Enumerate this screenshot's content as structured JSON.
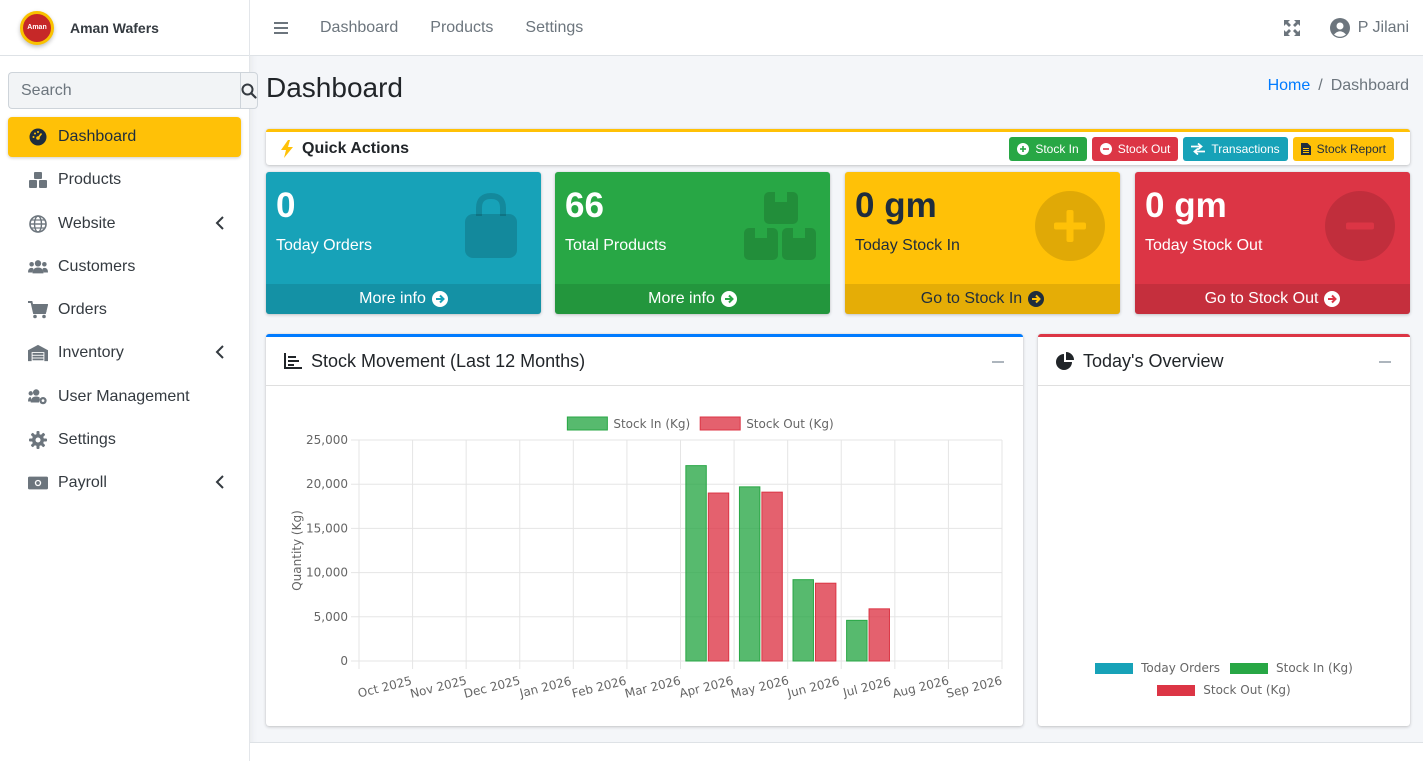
{
  "brand": {
    "logo_text": "Aman",
    "name": "Aman Wafers"
  },
  "search": {
    "placeholder": "Search"
  },
  "sidebar": {
    "items": [
      {
        "label": "Dashboard",
        "icon": "tachometer-icon",
        "active": true
      },
      {
        "label": "Products",
        "icon": "boxes-icon"
      },
      {
        "label": "Website",
        "icon": "globe-icon",
        "submenu": true
      },
      {
        "label": "Customers",
        "icon": "users-icon"
      },
      {
        "label": "Orders",
        "icon": "cart-icon"
      },
      {
        "label": "Inventory",
        "icon": "warehouse-icon",
        "submenu": true
      },
      {
        "label": "User Management",
        "icon": "users-cog-icon"
      },
      {
        "label": "Settings",
        "icon": "gear-icon"
      },
      {
        "label": "Payroll",
        "icon": "money-icon",
        "submenu": true
      }
    ]
  },
  "topnav": {
    "links": [
      "Dashboard",
      "Products",
      "Settings"
    ],
    "user_name": "P Jilani"
  },
  "header": {
    "title": "Dashboard",
    "breadcrumb_home": "Home",
    "breadcrumb_sep": "/",
    "breadcrumb_current": "Dashboard"
  },
  "quick_actions": {
    "title": "Quick Actions",
    "buttons": [
      "Stock In",
      "Stock Out",
      "Transactions",
      "Stock Report"
    ]
  },
  "boxes": [
    {
      "value": "0",
      "label": "Today Orders",
      "footer": "More info",
      "icon": "shopping-bag-icon"
    },
    {
      "value": "66",
      "label": "Total Products",
      "footer": "More info",
      "icon": "boxes-icon"
    },
    {
      "value": "0 gm",
      "label": "Today Stock In",
      "footer": "Go to Stock In",
      "icon": "plus-circle-icon"
    },
    {
      "value": "0 gm",
      "label": "Today Stock Out",
      "footer": "Go to Stock Out",
      "icon": "minus-circle-icon"
    }
  ],
  "colors": {
    "info": "#17a2b8",
    "success": "#28a745",
    "warning": "#ffc107",
    "danger": "#dc3545",
    "primary": "#007bff"
  },
  "stock_card": {
    "title": "Stock Movement (Last 12 Months)"
  },
  "overview_card": {
    "title": "Today's Overview",
    "legend": [
      "Today Orders",
      "Stock In (Kg)",
      "Stock Out (Kg)"
    ]
  },
  "chart_data": {
    "type": "bar",
    "categories": [
      "Oct 2025",
      "Nov 2025",
      "Dec 2025",
      "Jan 2026",
      "Feb 2026",
      "Mar 2026",
      "Apr 2026",
      "May 2026",
      "Jun 2026",
      "Jul 2026",
      "Aug 2026",
      "Sep 2026"
    ],
    "series": [
      {
        "name": "Stock In (Kg)",
        "color": "#28a745",
        "values": [
          0,
          0,
          0,
          0,
          0,
          0,
          22100,
          19700,
          9200,
          4600,
          0,
          0
        ]
      },
      {
        "name": "Stock Out (Kg)",
        "color": "#dc3545",
        "values": [
          0,
          0,
          0,
          0,
          0,
          0,
          19000,
          19100,
          8800,
          5900,
          0,
          0
        ]
      }
    ],
    "ylabel": "Quantity (Kg)",
    "xlabel": "",
    "ylim": [
      0,
      25000
    ],
    "yticks": [
      "0",
      "5,000",
      "10,000",
      "15,000",
      "20,000",
      "25,000"
    ],
    "legend_position": "top",
    "grid": true
  }
}
